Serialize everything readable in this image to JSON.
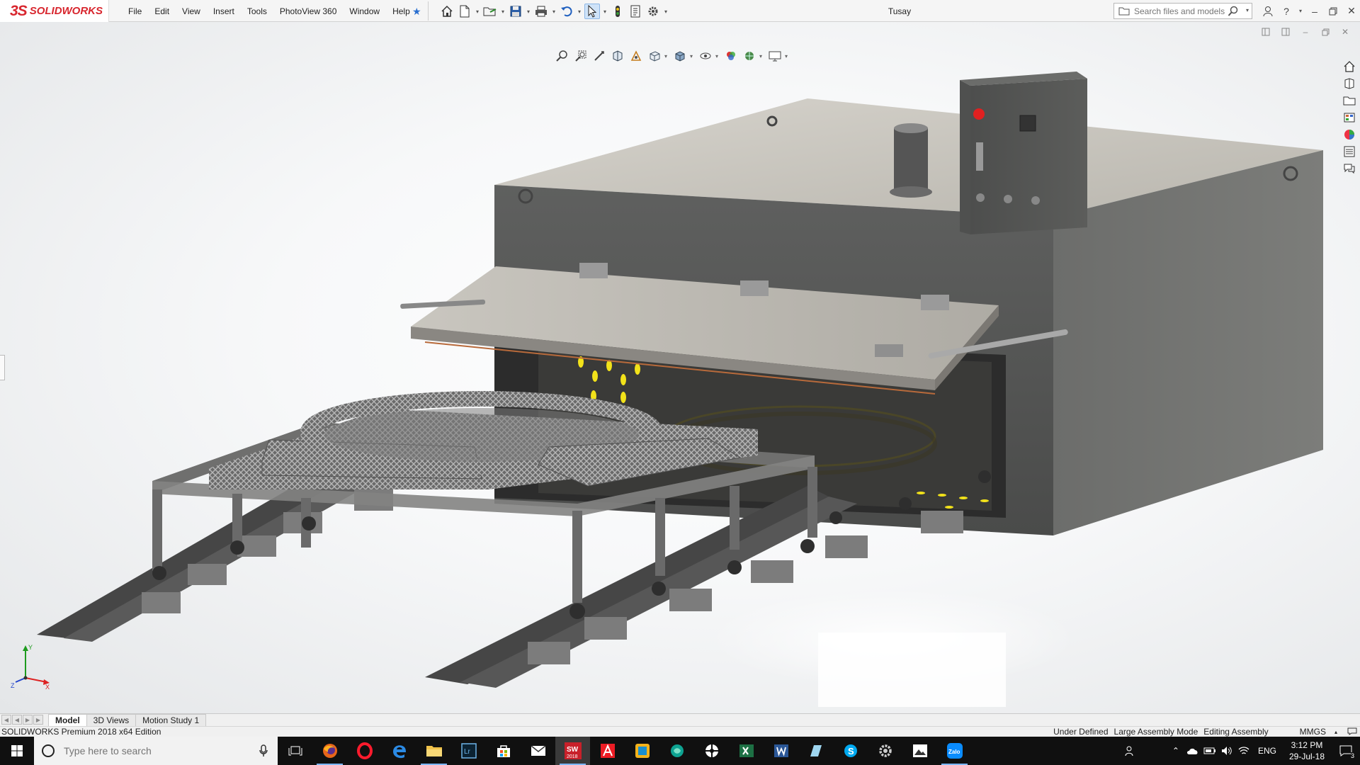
{
  "app": {
    "brand_mark": "3S",
    "brand_name": "SOLIDWORKS",
    "document_title": "Tusay"
  },
  "menu": [
    "File",
    "Edit",
    "View",
    "Insert",
    "Tools",
    "PhotoView 360",
    "Window",
    "Help"
  ],
  "search": {
    "placeholder": "Search files and models"
  },
  "tabs": [
    {
      "label": "Model",
      "active": true
    },
    {
      "label": "3D Views",
      "active": false
    },
    {
      "label": "Motion Study 1",
      "active": false
    }
  ],
  "status": {
    "edition": "SOLIDWORKS Premium 2018 x64 Edition",
    "definition": "Under Defined",
    "mode": "Large Assembly Mode",
    "editing": "Editing Assembly",
    "units": "MMGS"
  },
  "triad": {
    "x": "X",
    "y": "Y",
    "z": "Z"
  },
  "taskbar": {
    "search_placeholder": "Type here to search",
    "app_badge": "2018",
    "language": "ENG",
    "time": "3:12 PM",
    "date": "29-Jul-18",
    "notification_count": "3"
  },
  "colors": {
    "brand_red": "#d8262e",
    "selection_blue": "#cfe3f8",
    "taskbar_bg": "#101010"
  }
}
